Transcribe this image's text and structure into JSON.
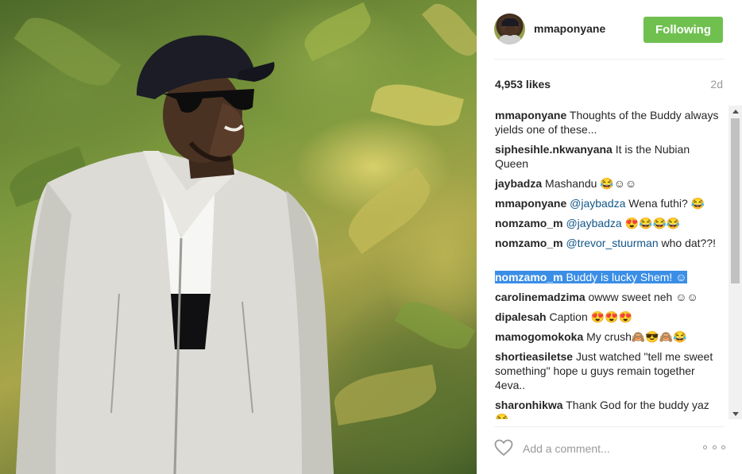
{
  "post": {
    "username": "mmaponyane",
    "follow_button": "Following",
    "likes": "4,953 likes",
    "age": "2d",
    "add_comment_placeholder": "Add a comment..."
  },
  "comments": [
    {
      "user": "mmaponyane",
      "text": " Thoughts of the Buddy always yields one of these..."
    },
    {
      "user": "siphesihle.nkwanyana",
      "text": " It is the Nubian Queen"
    },
    {
      "user": "jaybadza",
      "text": " Mashandu 😂☺☺"
    },
    {
      "user": "mmaponyane",
      "pre": " ",
      "mention": "@jaybadza",
      "text": " Wena futhi? 😂"
    },
    {
      "user": "nomzamo_m",
      "pre": " ",
      "mention": "@jaybadza",
      "text": " 😍😂😂😂"
    },
    {
      "user": "nomzamo_m",
      "pre": " ",
      "mention": "@trevor_stuurman",
      "text": " who dat??!"
    },
    {
      "user": "nomzamo_m",
      "text": " Buddy is lucky Shem! ☺"
    },
    {
      "user": "carolinemadzima",
      "text": " owww sweet neh ☺☺"
    },
    {
      "user": "dipalesah",
      "text": " Caption 😍😍😍"
    },
    {
      "user": "mamogomokoka",
      "text": " My crush🙈😎🙈😂"
    },
    {
      "user": "shortieasiletse",
      "text": " Just watched \"tell me sweet something\" hope u guys remain together 4eva.."
    },
    {
      "user": "sharonhikwa",
      "text": " Thank God for the buddy yaz 😂"
    }
  ],
  "icons": {
    "heart": "heart-icon",
    "more": "more-options-icon",
    "scroll_up": "scroll-up-arrow-icon",
    "scroll_down": "scroll-down-arrow-icon"
  },
  "colors": {
    "follow_button": "#70c050",
    "mention": "#125688",
    "selection": "#3a8ee6"
  }
}
